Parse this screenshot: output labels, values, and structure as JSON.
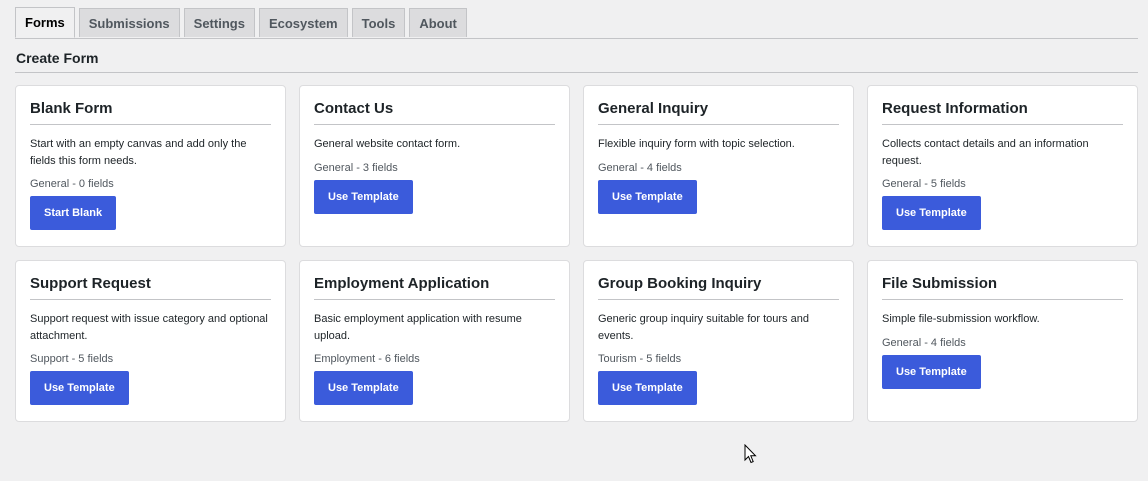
{
  "tabs": [
    {
      "label": "Forms",
      "active": true
    },
    {
      "label": "Submissions",
      "active": false
    },
    {
      "label": "Settings",
      "active": false
    },
    {
      "label": "Ecosystem",
      "active": false
    },
    {
      "label": "Tools",
      "active": false
    },
    {
      "label": "About",
      "active": false
    }
  ],
  "section": {
    "title": "Create Form"
  },
  "cards": [
    {
      "title": "Blank Form",
      "description": "Start with an empty canvas and add only the fields this form needs.",
      "meta": "General - 0 fields",
      "button": "Start Blank"
    },
    {
      "title": "Contact Us",
      "description": "General website contact form.",
      "meta": "General - 3 fields",
      "button": "Use Template"
    },
    {
      "title": "General Inquiry",
      "description": "Flexible inquiry form with topic selection.",
      "meta": "General - 4 fields",
      "button": "Use Template"
    },
    {
      "title": "Request Information",
      "description": "Collects contact details and an information request.",
      "meta": "General - 5 fields",
      "button": "Use Template"
    },
    {
      "title": "Support Request",
      "description": "Support request with issue category and optional attachment.",
      "meta": "Support - 5 fields",
      "button": "Use Template"
    },
    {
      "title": "Employment Application",
      "description": "Basic employment application with resume upload.",
      "meta": "Employment - 6 fields",
      "button": "Use Template"
    },
    {
      "title": "Group Booking Inquiry",
      "description": "Generic group inquiry suitable for tours and events.",
      "meta": "Tourism - 5 fields",
      "button": "Use Template"
    },
    {
      "title": "File Submission",
      "description": "Simple file-submission workflow.",
      "meta": "General - 4 fields",
      "button": "Use Template"
    }
  ],
  "colors": {
    "accent": "#3b5bdb",
    "background": "#f0f0f1"
  },
  "icons": {
    "cursor": "mouse-pointer-icon"
  }
}
